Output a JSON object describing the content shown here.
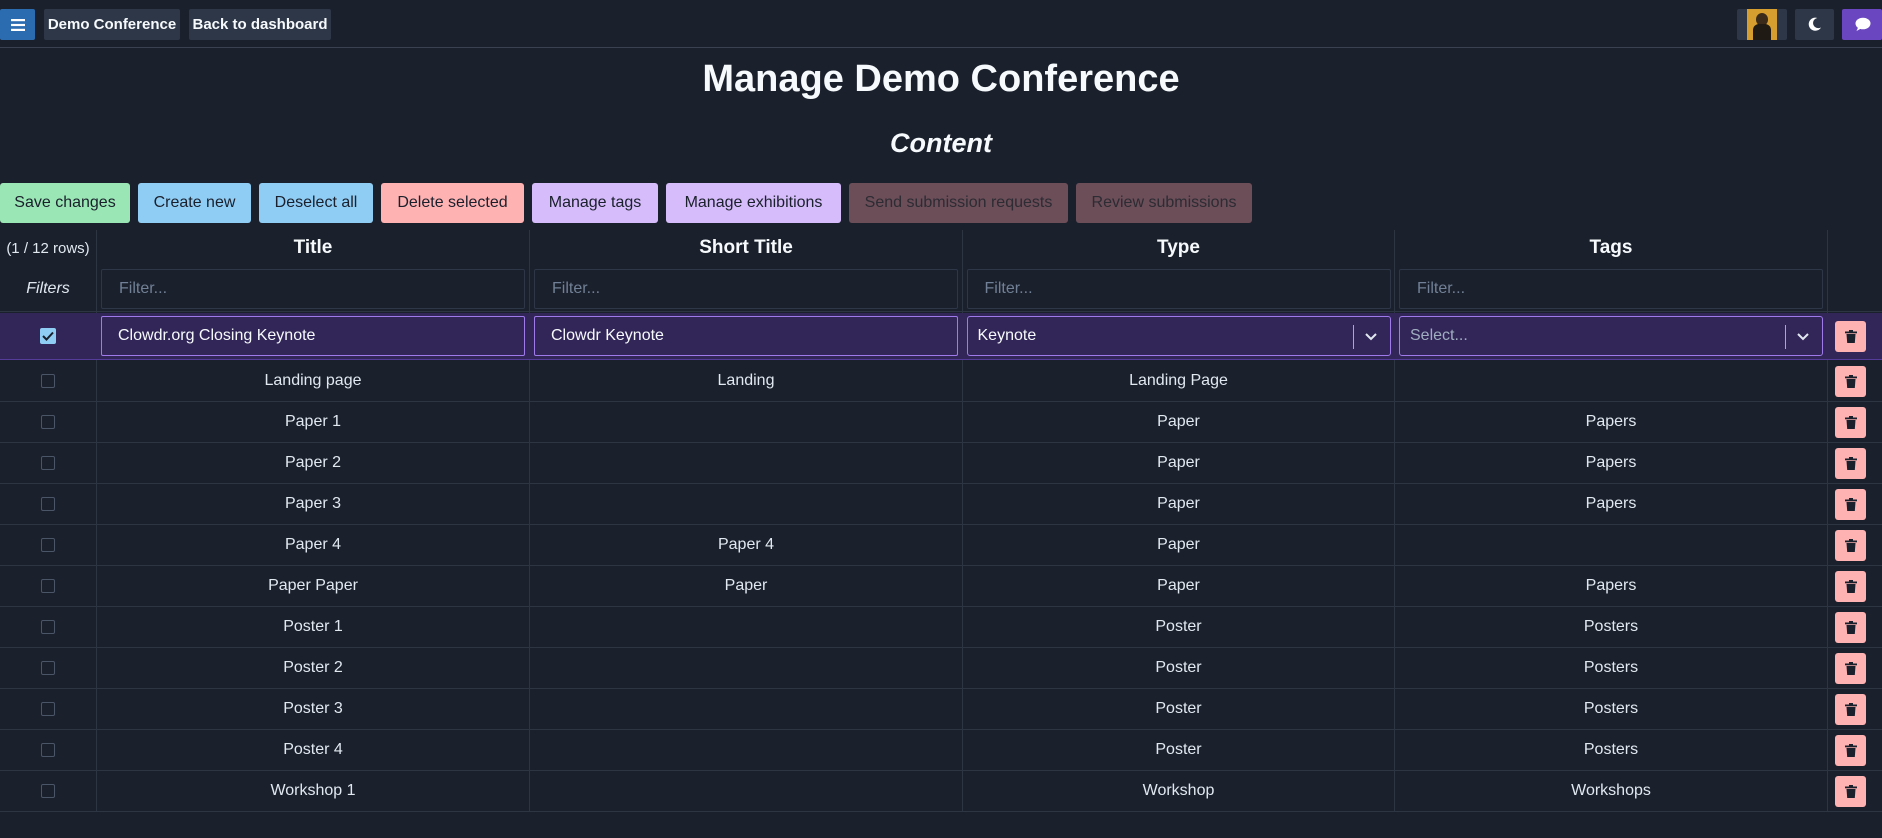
{
  "topbar": {
    "menu_icon": "hamburger-icon",
    "conference_label": "Demo Conference",
    "back_label": "Back to dashboard",
    "avatar_icon": "user-avatar",
    "theme_icon": "moon-icon",
    "chat_icon": "chat-bubble-icon"
  },
  "page": {
    "title": "Manage Demo Conference",
    "section": "Content"
  },
  "actions": {
    "save": "Save changes",
    "create": "Create new",
    "deselect": "Deselect all",
    "delete": "Delete selected",
    "tags": "Manage tags",
    "exhibitions": "Manage exhibitions",
    "send_requests": "Send submission requests",
    "review": "Review submissions"
  },
  "table": {
    "row_count": "(1 / 12 rows)",
    "filters_label": "Filters",
    "filter_placeholder": "Filter...",
    "columns": [
      "Title",
      "Short Title",
      "Type",
      "Tags"
    ],
    "editing_row": {
      "checked": true,
      "title": "Clowdr.org Closing Keynote",
      "short_title": "Clowdr Keynote",
      "type": "Keynote",
      "tags_placeholder": "Select..."
    },
    "rows": [
      {
        "title": "Landing page",
        "short_title": "Landing",
        "type": "Landing Page",
        "tags": ""
      },
      {
        "title": "Paper 1",
        "short_title": "",
        "type": "Paper",
        "tags": "Papers"
      },
      {
        "title": "Paper 2",
        "short_title": "",
        "type": "Paper",
        "tags": "Papers"
      },
      {
        "title": "Paper 3",
        "short_title": "",
        "type": "Paper",
        "tags": "Papers"
      },
      {
        "title": "Paper 4",
        "short_title": "Paper 4",
        "type": "Paper",
        "tags": ""
      },
      {
        "title": "Paper Paper",
        "short_title": "Paper",
        "type": "Paper",
        "tags": "Papers"
      },
      {
        "title": "Poster 1",
        "short_title": "",
        "type": "Poster",
        "tags": "Posters"
      },
      {
        "title": "Poster 2",
        "short_title": "",
        "type": "Poster",
        "tags": "Posters"
      },
      {
        "title": "Poster 3",
        "short_title": "",
        "type": "Poster",
        "tags": "Posters"
      },
      {
        "title": "Poster 4",
        "short_title": "",
        "type": "Poster",
        "tags": "Posters"
      },
      {
        "title": "Workshop 1",
        "short_title": "",
        "type": "Workshop",
        "tags": "Workshops"
      }
    ]
  }
}
